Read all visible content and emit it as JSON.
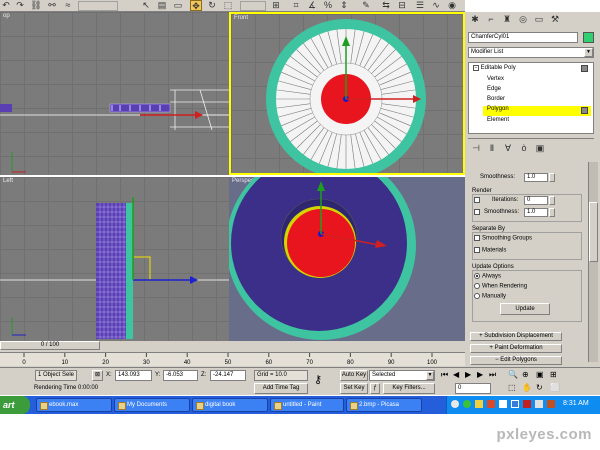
{
  "viewports": {
    "top_left_label": "op",
    "front_label": "Front",
    "left_label": "Left",
    "perspective_label": "Perspective"
  },
  "command_panel": {
    "object_name": "ChamferCyl01",
    "modifier_list": "Modifier List",
    "stack": [
      "Editable Poly",
      "Vertex",
      "Edge",
      "Border",
      "Polygon",
      "Element"
    ],
    "selected_stack_index": 4,
    "smoothness_label": "Smoothness:",
    "smoothness_value": "1.0",
    "render_title": "Render",
    "iterations_label": "Iterations:",
    "iterations_value": "0",
    "render_smoothness_label": "Smoothness:",
    "render_smoothness_value": "1.0",
    "separate_by_title": "Separate By",
    "smoothing_groups": "Smoothing Groups",
    "materials": "Materials",
    "update_options_title": "Update Options",
    "always": "Always",
    "when_rendering": "When Rendering",
    "manually": "Manually",
    "update_button": "Update",
    "subdivision_displacement": "Subdivision Displacement",
    "paint_deformation": "Paint Deformation",
    "edit_polygons": "Edit Polygons"
  },
  "timeline": {
    "frame_counter": "0 / 100",
    "ticks": [
      "0",
      "10",
      "20",
      "30",
      "40",
      "50",
      "60",
      "70",
      "80",
      "90",
      "100"
    ]
  },
  "status": {
    "selection": "1 Object Sele",
    "x_label": "X:",
    "x_value": "143.093",
    "y_label": "Y:",
    "y_value": "-6.053",
    "z_label": "Z:",
    "z_value": "-24.147",
    "grid": "Grid = 10.0",
    "rendering_time": "Rendering Time  0:00:00",
    "add_time_tag": "Add Time Tag",
    "auto_key": "Auto Key",
    "auto_key_value": "Selected",
    "set_key": "Set Key",
    "key_filters": "Key Filters...",
    "frame_value": "0"
  },
  "taskbar": {
    "start": "art",
    "tasks": [
      "ebook.max",
      "My Documents",
      "digital book",
      "untitled - Paint",
      "2.bmp - Picasa"
    ],
    "clock": "8:31 AM"
  },
  "watermark": "pxleyes.com",
  "colors": {
    "ui_gray": "#d4d0c8",
    "viewport_gray": "#7b7b7b",
    "selection_yellow": "#ffff00",
    "object_green": "#3ec4a0",
    "taskbar_blue": "#245edb",
    "purple_face": "#3b2f8a"
  }
}
